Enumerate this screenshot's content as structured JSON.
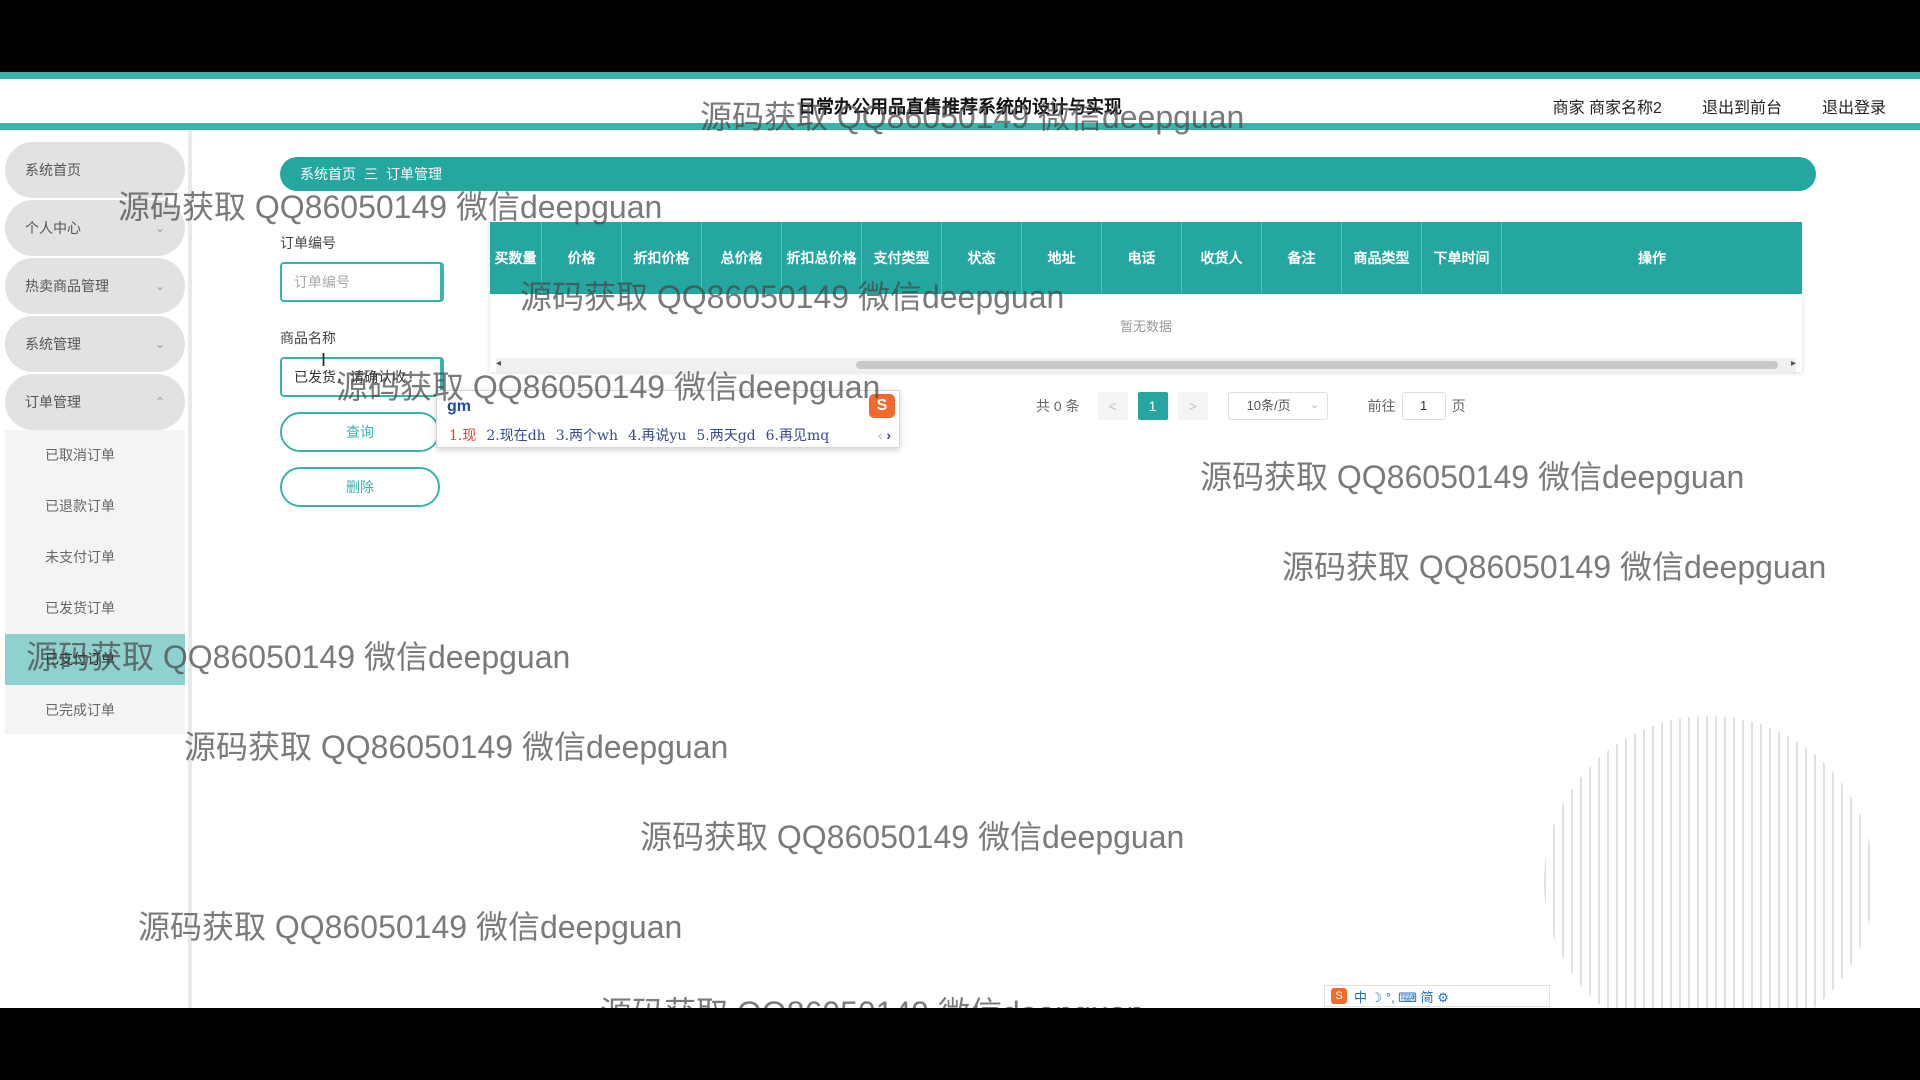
{
  "header": {
    "title": "日常办公用品直售推荐系统的设计与实现",
    "user_label": "商家 商家名称2",
    "front_label": "退出到前台",
    "logout_label": "退出登录"
  },
  "sidebar": {
    "items": [
      {
        "label": "系统首页"
      },
      {
        "label": "个人中心"
      },
      {
        "label": "热卖商品管理"
      },
      {
        "label": "系统管理"
      },
      {
        "label": "订单管理"
      }
    ],
    "sub_items": [
      {
        "label": "已取消订单"
      },
      {
        "label": "已退款订单"
      },
      {
        "label": "未支付订单"
      },
      {
        "label": "已发货订单"
      },
      {
        "label": "已支付订单"
      },
      {
        "label": "已完成订单"
      }
    ],
    "active_sub": "已支付订单"
  },
  "breadcrumb": {
    "home": "系统首页",
    "separator": "三",
    "current": "订单管理"
  },
  "search": {
    "order_no_label": "订单编号",
    "order_no_placeholder": "订单编号",
    "goods_name_label": "商品名称",
    "goods_name_value": "已发货，请确认收",
    "query_label": "查询",
    "delete_label": "删除"
  },
  "table": {
    "columns": [
      "买数量",
      "价格",
      "折扣价格",
      "总价格",
      "折扣总价格",
      "支付类型",
      "状态",
      "地址",
      "电话",
      "收货人",
      "备注",
      "商品类型",
      "下单时间",
      "操作"
    ],
    "empty_text": "暂无数据"
  },
  "pagination": {
    "total_text": "共 0 条",
    "prev": "<",
    "current_page": "1",
    "next": ">",
    "page_size": "10条/页",
    "goto_label": "前往",
    "goto_value": "1",
    "page_unit": "页"
  },
  "ime": {
    "input": "gm",
    "candidates": [
      "1.现",
      "2.现在dh",
      "3.两个wh",
      "4.再说yu",
      "5.两天gd",
      "6.再见mq"
    ],
    "toolbar": "中 ☽ °, ⌨ 简 ⚙"
  },
  "watermark": "源码获取 QQ86050149 微信deepguan",
  "colors": {
    "accent": "#26a6a0",
    "accent_light": "#8fd1ce",
    "border": "#3bb3ad"
  }
}
